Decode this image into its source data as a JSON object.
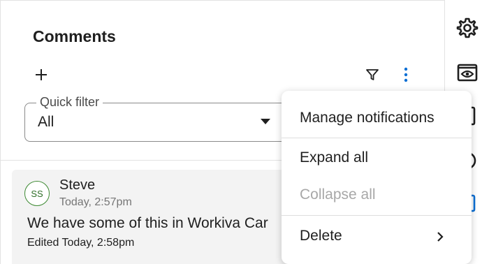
{
  "panel": {
    "title": "Comments",
    "quick_filter": {
      "label": "Quick filter",
      "value": "All"
    }
  },
  "comment": {
    "initials": "SS",
    "author": "Steve",
    "timestamp": "Today, 2:57pm",
    "text": "We have some of this in Workiva Car",
    "edited": "Edited Today, 2:58pm"
  },
  "menu": {
    "items": [
      {
        "label": "Manage notifications",
        "enabled": true
      },
      {
        "label": "Expand all",
        "enabled": true
      },
      {
        "label": "Collapse all",
        "enabled": false
      },
      {
        "label": "Delete",
        "enabled": true,
        "has_submenu": true
      }
    ]
  },
  "rail": {
    "icons": [
      "gear-icon",
      "eye-icon",
      "panel-icon",
      "history-icon",
      "comments-icon"
    ]
  },
  "colors": {
    "accent": "#0b6fd4",
    "avatar_border": "#3e8a33",
    "disabled_text": "#a8a8a8"
  }
}
